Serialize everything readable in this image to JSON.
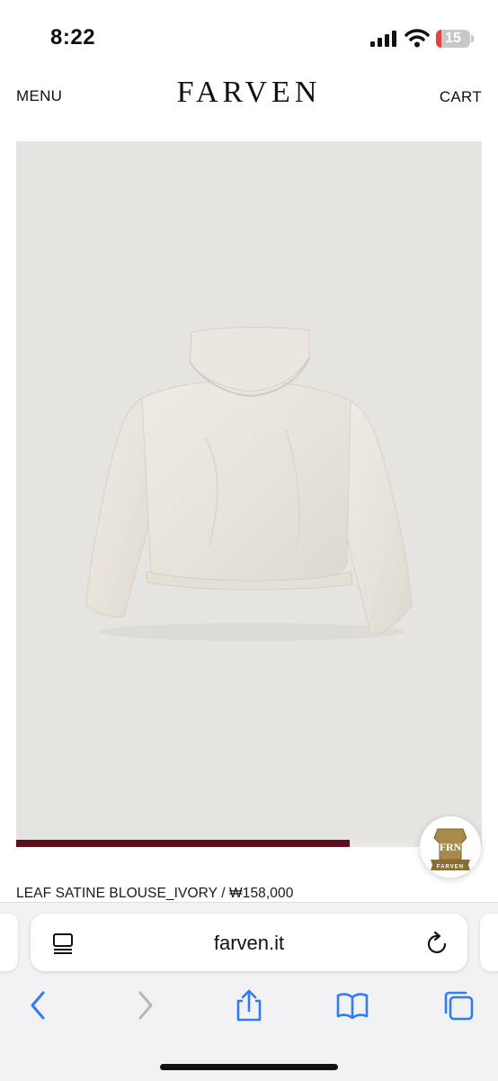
{
  "status_bar": {
    "time": "8:22",
    "battery": "15",
    "battery_level": 0.15
  },
  "header": {
    "menu": "MENU",
    "logo": "FARVEN",
    "cart": "CART"
  },
  "gallery": {
    "progress": 0.716
  },
  "badge": {
    "monogram": "FRN",
    "banner": "FARVEN"
  },
  "product": {
    "caption": "LEAF SATINE BLOUSE_IVORY / ₩158,000"
  },
  "browser": {
    "url": "farven.it"
  },
  "icons": [
    "signal-icon",
    "wifi-icon",
    "battery-icon",
    "reader-icon",
    "reload-icon",
    "back-icon",
    "forward-icon",
    "share-icon",
    "bookmarks-icon",
    "tabs-icon"
  ],
  "colors": {
    "accent": "#5a101c",
    "image_bg": "#e6e4e1",
    "ios_blue": "#2e7cf6"
  }
}
